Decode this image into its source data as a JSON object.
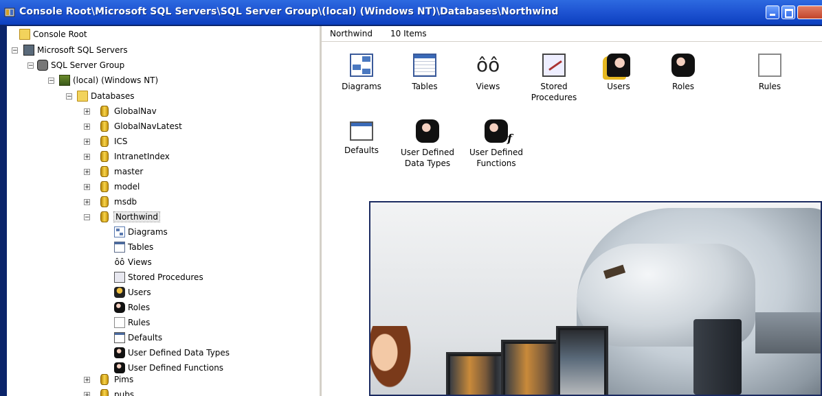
{
  "window": {
    "title": "Console Root\\Microsoft SQL Servers\\SQL Server Group\\(local) (Windows NT)\\Databases\\Northwind"
  },
  "tree": {
    "items": [
      {
        "label": "Console Root",
        "icon": "folder-icon"
      },
      {
        "label": "Microsoft SQL Servers",
        "icon": "server-icon"
      },
      {
        "label": "SQL Server Group",
        "icon": "server-group-icon"
      },
      {
        "label": "(local) (Windows NT)",
        "icon": "local-server-icon"
      },
      {
        "label": "Databases",
        "icon": "folder-icon"
      },
      {
        "label": "GlobalNav",
        "icon": "database-icon"
      },
      {
        "label": "GlobalNavLatest",
        "icon": "database-icon"
      },
      {
        "label": "ICS",
        "icon": "database-icon"
      },
      {
        "label": "IntranetIndex",
        "icon": "database-icon"
      },
      {
        "label": "master",
        "icon": "database-icon"
      },
      {
        "label": "model",
        "icon": "database-icon"
      },
      {
        "label": "msdb",
        "icon": "database-icon"
      },
      {
        "label": "Northwind",
        "icon": "database-icon"
      },
      {
        "label": "Diagrams",
        "icon": "diagram-icon"
      },
      {
        "label": "Tables",
        "icon": "table-icon"
      },
      {
        "label": "Views",
        "icon": "glasses-icon"
      },
      {
        "label": "Stored Procedures",
        "icon": "stored-procedure-icon"
      },
      {
        "label": "Users",
        "icon": "user-icon"
      },
      {
        "label": "Roles",
        "icon": "roles-icon"
      },
      {
        "label": "Rules",
        "icon": "rule-icon"
      },
      {
        "label": "Defaults",
        "icon": "default-icon"
      },
      {
        "label": "User Defined Data Types",
        "icon": "user-defined-type-icon"
      },
      {
        "label": "User Defined Functions",
        "icon": "user-defined-function-icon"
      },
      {
        "label": "Pims",
        "icon": "database-icon"
      },
      {
        "label": "pubs",
        "icon": "database-icon"
      }
    ]
  },
  "details": {
    "name": "Northwind",
    "count": "10 Items",
    "items": [
      {
        "label": "Diagrams",
        "icon": "diagram-icon"
      },
      {
        "label": "Tables",
        "icon": "table-icon"
      },
      {
        "label": "Views",
        "icon": "glasses-icon"
      },
      {
        "label": "Stored Procedures",
        "icon": "stored-procedure-icon"
      },
      {
        "label": "Users",
        "icon": "user-icon"
      },
      {
        "label": "Roles",
        "icon": "roles-icon"
      },
      {
        "label": "Rules",
        "icon": "rule-icon"
      },
      {
        "label": "Defaults",
        "icon": "default-icon"
      },
      {
        "label": "User Defined Data Types",
        "icon": "user-defined-type-icon"
      },
      {
        "label": "User Defined Functions",
        "icon": "user-defined-function-icon"
      }
    ]
  },
  "colors": {
    "titlebar": "#1f55d3",
    "tree_background": "#ffffff",
    "folder": "#f2d35c",
    "database": "#e0b020"
  }
}
